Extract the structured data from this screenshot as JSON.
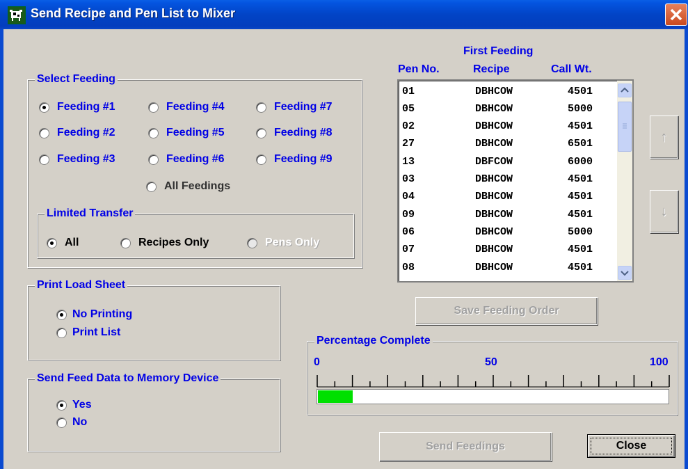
{
  "window": {
    "title": "Send Recipe and Pen List to Mixer"
  },
  "select_feeding": {
    "label": "Select Feeding",
    "options": [
      "Feeding #1",
      "Feeding #4",
      "Feeding #7",
      "Feeding #2",
      "Feeding #5",
      "Feeding #8",
      "Feeding #3",
      "Feeding #6",
      "Feeding #9"
    ],
    "selected": "Feeding #1",
    "all_label": "All Feedings"
  },
  "limited_transfer": {
    "label": "Limited Transfer",
    "options": [
      "All",
      "Recipes Only",
      "Pens Only"
    ],
    "selected": "All"
  },
  "print_load_sheet": {
    "label": "Print Load Sheet",
    "options": [
      "No Printing",
      "Print List"
    ],
    "selected": "No Printing"
  },
  "memory_device": {
    "label": "Send Feed Data to Memory Device",
    "options": [
      "Yes",
      "No"
    ],
    "selected": "Yes"
  },
  "feeding_list": {
    "heading": "First Feeding",
    "columns": [
      "Pen No.",
      "Recipe",
      "Call Wt."
    ],
    "rows": [
      [
        "01",
        "DBHCOW",
        "4501"
      ],
      [
        "05",
        "DBHCOW",
        "5000"
      ],
      [
        "02",
        "DBHCOW",
        "4501"
      ],
      [
        "27",
        "DBHCOW",
        "6501"
      ],
      [
        "13",
        "DBFCOW",
        "6000"
      ],
      [
        "03",
        "DBHCOW",
        "4501"
      ],
      [
        "04",
        "DBHCOW",
        "4501"
      ],
      [
        "09",
        "DBHCOW",
        "4501"
      ],
      [
        "06",
        "DBHCOW",
        "5000"
      ],
      [
        "07",
        "DBHCOW",
        "4501"
      ],
      [
        "08",
        "DBHCOW",
        "4501"
      ]
    ]
  },
  "buttons": {
    "move_up": "↑",
    "move_down": "↓",
    "save_order": "Save Feeding Order",
    "send": "Send Feedings",
    "close": "Close"
  },
  "progress": {
    "label": "Percentage Complete",
    "scale": [
      "0",
      "50",
      "100"
    ],
    "percent": 10,
    "fill_color": "#00e000"
  },
  "colors": {
    "label_blue": "#0000e6",
    "title_bar": "#0244c6"
  }
}
